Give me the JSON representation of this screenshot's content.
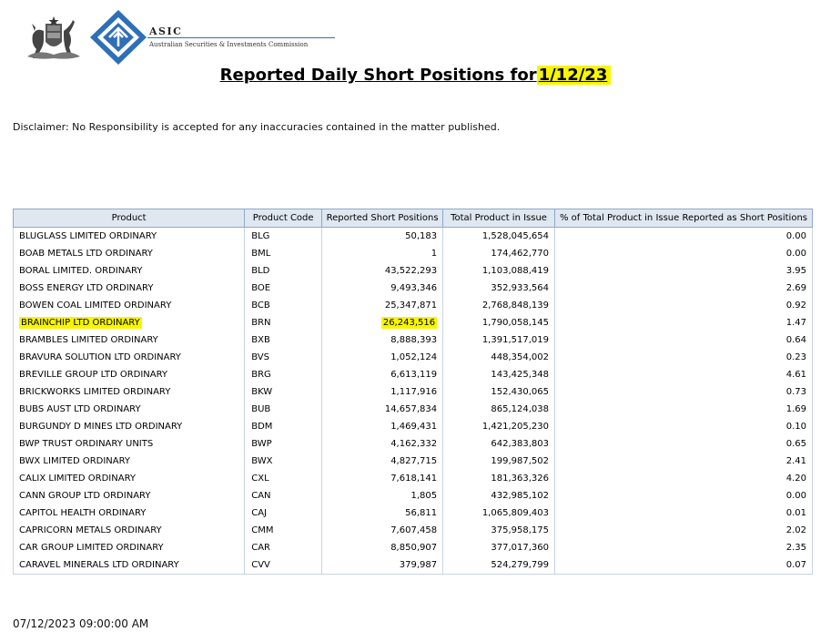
{
  "header": {
    "org_abbrev": "ASIC",
    "org_full_name": "Australian Securities & Investments Commission"
  },
  "title": {
    "prefix": "Reported Daily Short Positions for",
    "date": "1/12/23",
    "date_highlight_color": "#f7f500"
  },
  "disclaimer": "Disclaimer: No Responsibility is accepted for any inaccuracies contained in the matter published.",
  "table": {
    "columns": [
      "Product",
      "Product Code",
      "Reported Short Positions",
      "Total Product in Issue",
      "% of Total Product in Issue Reported as Short Positions"
    ],
    "rows": [
      {
        "product": "BLUGLASS LIMITED ORDINARY",
        "code": "BLG",
        "short": "50,183",
        "total": "1,528,045,654",
        "pct": "0.00"
      },
      {
        "product": "BOAB METALS LTD ORDINARY",
        "code": "BML",
        "short": "1",
        "total": "174,462,770",
        "pct": "0.00"
      },
      {
        "product": "BORAL LIMITED. ORDINARY",
        "code": "BLD",
        "short": "43,522,293",
        "total": "1,103,088,419",
        "pct": "3.95"
      },
      {
        "product": "BOSS ENERGY LTD ORDINARY",
        "code": "BOE",
        "short": "9,493,346",
        "total": "352,933,564",
        "pct": "2.69"
      },
      {
        "product": "BOWEN COAL LIMITED ORDINARY",
        "code": "BCB",
        "short": "25,347,871",
        "total": "2,768,848,139",
        "pct": "0.92"
      },
      {
        "product": "BRAINCHIP LTD ORDINARY",
        "code": "BRN",
        "short": "26,243,516",
        "total": "1,790,058,145",
        "pct": "1.47",
        "highlighted": true
      },
      {
        "product": "BRAMBLES LIMITED ORDINARY",
        "code": "BXB",
        "short": "8,888,393",
        "total": "1,391,517,019",
        "pct": "0.64"
      },
      {
        "product": "BRAVURA SOLUTION LTD ORDINARY",
        "code": "BVS",
        "short": "1,052,124",
        "total": "448,354,002",
        "pct": "0.23"
      },
      {
        "product": "BREVILLE GROUP LTD ORDINARY",
        "code": "BRG",
        "short": "6,613,119",
        "total": "143,425,348",
        "pct": "4.61"
      },
      {
        "product": "BRICKWORKS LIMITED ORDINARY",
        "code": "BKW",
        "short": "1,117,916",
        "total": "152,430,065",
        "pct": "0.73"
      },
      {
        "product": "BUBS AUST LTD ORDINARY",
        "code": "BUB",
        "short": "14,657,834",
        "total": "865,124,038",
        "pct": "1.69"
      },
      {
        "product": "BURGUNDY D MINES LTD ORDINARY",
        "code": "BDM",
        "short": "1,469,431",
        "total": "1,421,205,230",
        "pct": "0.10"
      },
      {
        "product": "BWP TRUST ORDINARY UNITS",
        "code": "BWP",
        "short": "4,162,332",
        "total": "642,383,803",
        "pct": "0.65"
      },
      {
        "product": "BWX LIMITED ORDINARY",
        "code": "BWX",
        "short": "4,827,715",
        "total": "199,987,502",
        "pct": "2.41"
      },
      {
        "product": "CALIX LIMITED ORDINARY",
        "code": "CXL",
        "short": "7,618,141",
        "total": "181,363,326",
        "pct": "4.20"
      },
      {
        "product": "CANN GROUP LTD ORDINARY",
        "code": "CAN",
        "short": "1,805",
        "total": "432,985,102",
        "pct": "0.00"
      },
      {
        "product": "CAPITOL HEALTH ORDINARY",
        "code": "CAJ",
        "short": "56,811",
        "total": "1,065,809,403",
        "pct": "0.01"
      },
      {
        "product": "CAPRICORN METALS ORDINARY",
        "code": "CMM",
        "short": "7,607,458",
        "total": "375,958,175",
        "pct": "2.02"
      },
      {
        "product": "CAR GROUP LIMITED ORDINARY",
        "code": "CAR",
        "short": "8,850,907",
        "total": "377,017,360",
        "pct": "2.35"
      },
      {
        "product": "CARAVEL MINERALS LTD ORDINARY",
        "code": "CVV",
        "short": "379,987",
        "total": "524,279,799",
        "pct": "0.07"
      }
    ]
  },
  "footer": {
    "timestamp": "07/12/2023 09:00:00 AM"
  },
  "colors": {
    "header_bg": "#dfe7f1",
    "highlight": "#f7f500",
    "asic_blue": "#2e6fb7"
  },
  "icons": {
    "crest": "coat-of-arms-icon",
    "asic": "asic-diamond-logo-icon"
  }
}
